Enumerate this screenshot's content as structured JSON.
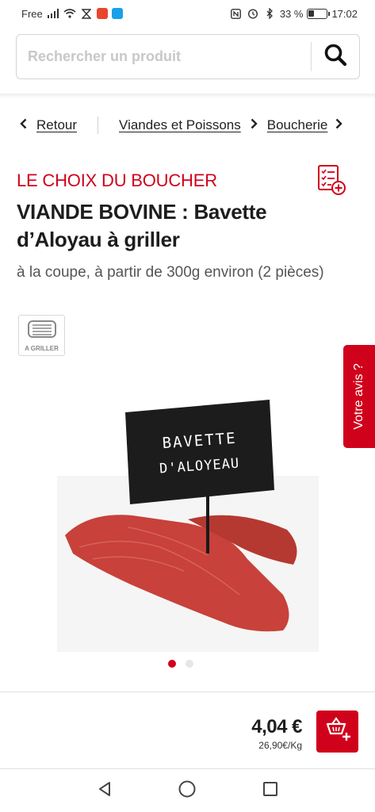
{
  "status_bar": {
    "carrier": "Free",
    "battery_percent": "33 %",
    "battery_level": 0.33,
    "time": "17:02"
  },
  "search": {
    "placeholder": "Rechercher un produit"
  },
  "breadcrumb": {
    "back_label": "Retour",
    "items": [
      "Viandes et Poissons",
      "Boucherie"
    ]
  },
  "product": {
    "brand": "LE CHOIX DU BOUCHER",
    "title": "VIANDE BOVINE : Bavette d’Aloyau à griller",
    "subtitle": "à la coupe, à partir de 300g environ (2 pièces)",
    "badge_label": "A GRILLER",
    "sign_text_line1": "BAVETTE",
    "sign_text_line2": "D'ALOYEAU",
    "price": "4,04 €",
    "unit_price": "26,90€/Kg"
  },
  "feedback": {
    "label": "Votre avis ?"
  },
  "carousel": {
    "count": 2,
    "active_index": 0
  },
  "colors": {
    "accent": "#d0021b"
  }
}
